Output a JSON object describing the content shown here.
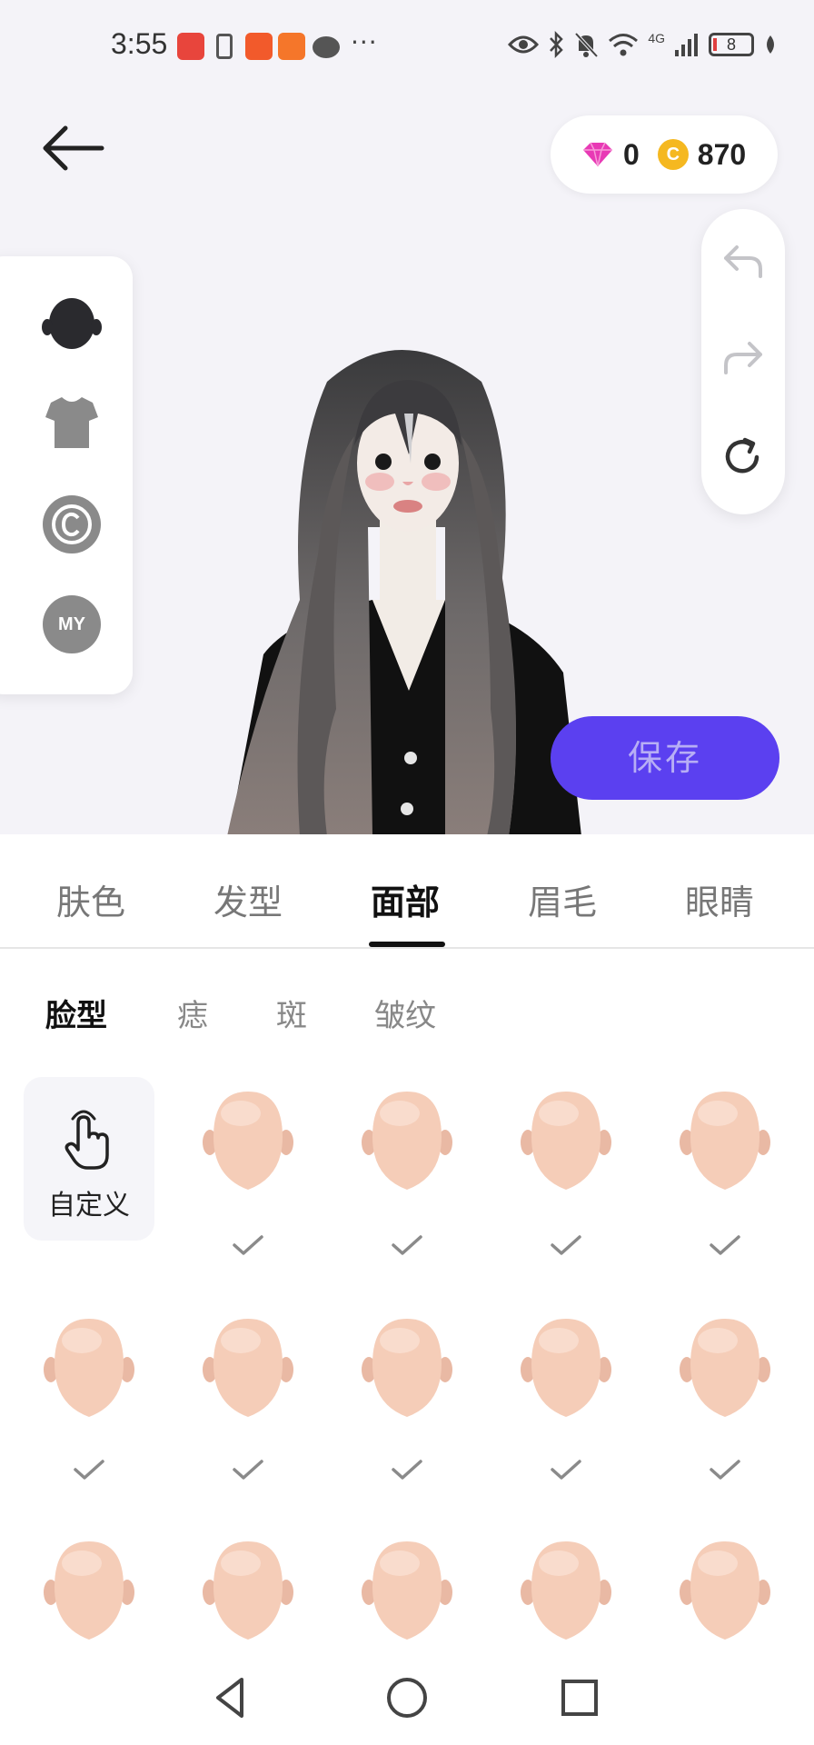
{
  "status_bar": {
    "time": "3:55",
    "more": "···",
    "battery": "8",
    "network": "4G"
  },
  "currency": {
    "gems": "0",
    "coins": "870",
    "coin_symbol": "C"
  },
  "left_menu": {
    "my_label": "MY"
  },
  "actions": {
    "save_label": "保存"
  },
  "tabs": [
    {
      "label": "肤色"
    },
    {
      "label": "发型"
    },
    {
      "label": "面部"
    },
    {
      "label": "眉毛"
    },
    {
      "label": "眼睛"
    }
  ],
  "subtabs": [
    {
      "label": "脸型"
    },
    {
      "label": "痣"
    },
    {
      "label": "斑"
    },
    {
      "label": "皱纹"
    }
  ],
  "face_grid": {
    "custom_label": "自定义"
  },
  "colors": {
    "accent": "#5b40f0",
    "save_text": "#b7aef5",
    "coin": "#f5b820",
    "gem": "#e83ab5",
    "skin": "#f5cdb8"
  }
}
